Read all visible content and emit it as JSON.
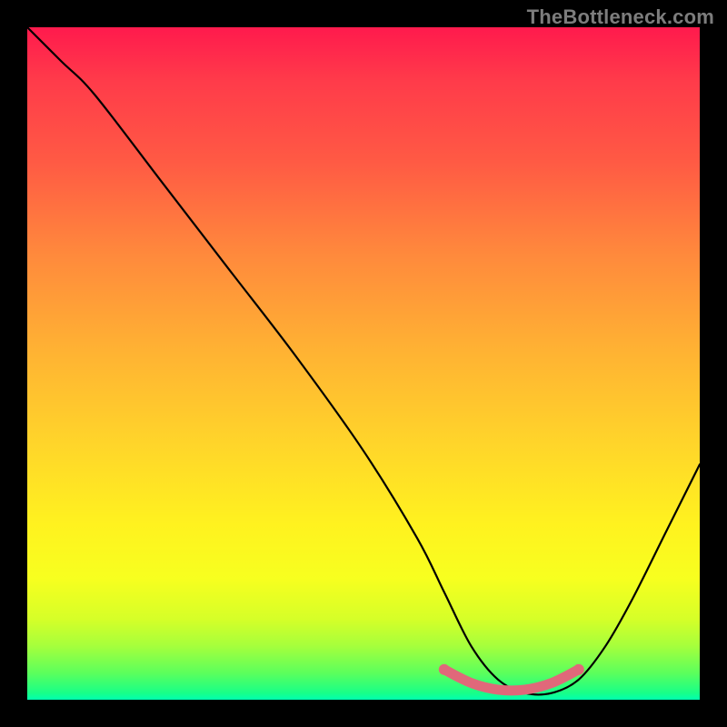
{
  "watermark": "TheBottleneck.com",
  "chart_data": {
    "type": "line",
    "title": "",
    "xlabel": "",
    "ylabel": "",
    "xlim": [
      0,
      100
    ],
    "ylim": [
      0,
      100
    ],
    "series": [
      {
        "name": "bottleneck-curve",
        "x": [
          0,
          5,
          10,
          20,
          30,
          40,
          50,
          58,
          62,
          66,
          70,
          74,
          78,
          82,
          86,
          90,
          95,
          100
        ],
        "values": [
          100,
          95,
          90,
          77,
          64,
          51,
          37,
          24,
          16,
          8,
          3,
          1,
          1,
          3,
          8,
          15,
          25,
          35
        ]
      }
    ],
    "highlight": {
      "name": "optimal-range",
      "x": [
        62,
        66,
        70,
        74,
        78,
        82
      ],
      "values": [
        4.5,
        2.5,
        1.5,
        1.5,
        2.5,
        4.5
      ],
      "color": "#e0687a"
    },
    "gradient_stops": [
      {
        "pos": 0,
        "color": "#ff1a4d"
      },
      {
        "pos": 50,
        "color": "#ffd52a"
      },
      {
        "pos": 90,
        "color": "#d6ff28"
      },
      {
        "pos": 100,
        "color": "#00ffb0"
      }
    ]
  }
}
